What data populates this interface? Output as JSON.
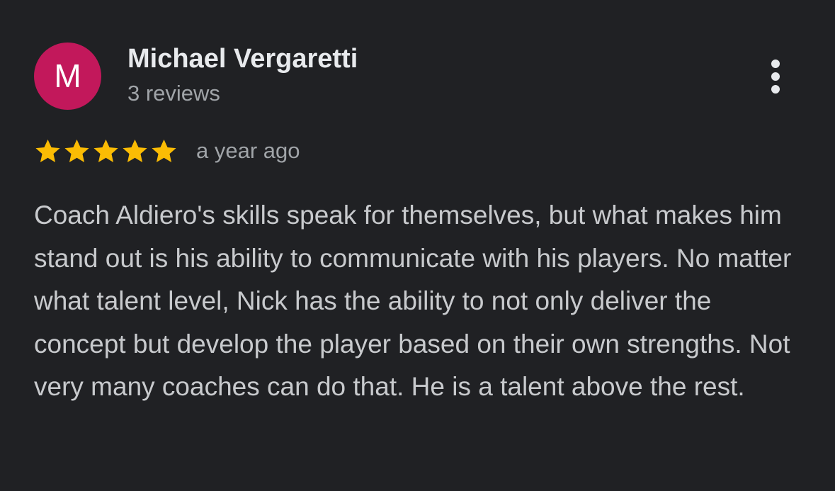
{
  "review": {
    "avatar_letter": "M",
    "author_name": "Michael Vergaretti",
    "review_count": "3 reviews",
    "rating": 5,
    "rating_max": 5,
    "timestamp": "a year ago",
    "text": "Coach Aldiero's skills speak for themselves, but what makes him stand out is his ability to communicate with his players. No matter what talent level, Nick has the ability to not only deliver the concept but develop the player based on their own strengths. Not very many coaches can do that. He is a talent above the rest."
  },
  "icons": {
    "more": "more-vert-icon",
    "star": "star-icon"
  },
  "colors": {
    "background": "#202124",
    "avatar": "#c2185b",
    "star": "#fbbc04",
    "name": "#e8eaed",
    "secondary_text": "#a0a4a8",
    "body_text": "#c8cacd"
  }
}
